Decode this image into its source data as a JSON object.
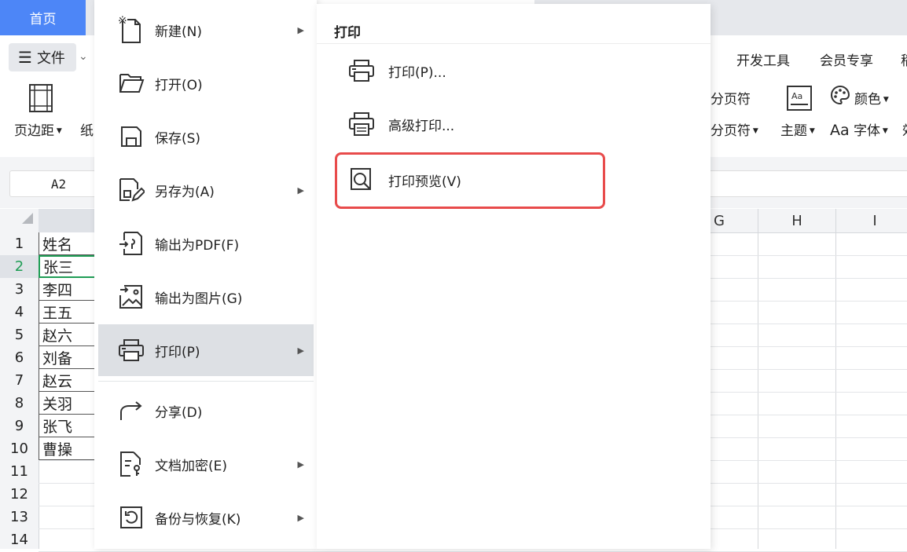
{
  "tabs": {
    "home": "首页"
  },
  "ribbon": {
    "file_label": "文件",
    "page_margin": "页边距",
    "paper": "纸",
    "page_break_1": "分页符",
    "page_break_2": "分页符",
    "theme": "主题",
    "color": "颜色",
    "font": "字体",
    "font_prefix": "Aa",
    "dev_tools": "开发工具",
    "member": "会员专享",
    "cut_tab": "稻",
    "cut_item": "效"
  },
  "formula": {
    "name_box": "A2"
  },
  "columns": [
    "G",
    "H",
    "I"
  ],
  "rows": [
    "1",
    "2",
    "3",
    "4",
    "5",
    "6",
    "7",
    "8",
    "9",
    "10",
    "11",
    "12",
    "13",
    "14"
  ],
  "cells": [
    "姓名",
    "张三",
    "李四",
    "王五",
    "赵六",
    "刘备",
    "赵云",
    "关羽",
    "张飞",
    "曹操"
  ],
  "file_menu": {
    "items": [
      {
        "label": "新建(N)",
        "icon": "new-file-icon",
        "submenu": true
      },
      {
        "label": "打开(O)",
        "icon": "folder-open-icon",
        "submenu": false
      },
      {
        "label": "保存(S)",
        "icon": "save-icon",
        "submenu": false
      },
      {
        "label": "另存为(A)",
        "icon": "save-as-icon",
        "submenu": true
      },
      {
        "label": "输出为PDF(F)",
        "icon": "export-pdf-icon",
        "submenu": false
      },
      {
        "label": "输出为图片(G)",
        "icon": "export-image-icon",
        "submenu": false
      },
      {
        "label": "打印(P)",
        "icon": "printer-icon",
        "submenu": true
      },
      {
        "label": "分享(D)",
        "icon": "share-icon",
        "submenu": false
      },
      {
        "label": "文档加密(E)",
        "icon": "encrypt-icon",
        "submenu": true
      },
      {
        "label": "备份与恢复(K)",
        "icon": "backup-icon",
        "submenu": true
      }
    ],
    "active_index": 6
  },
  "print_submenu": {
    "title": "打印",
    "items": [
      {
        "label": "打印(P)...",
        "icon": "printer-icon"
      },
      {
        "label": "高级打印...",
        "icon": "advanced-print-icon"
      },
      {
        "label": "打印预览(V)",
        "icon": "print-preview-icon"
      }
    ]
  },
  "colors": {
    "accent": "#4d86f7",
    "highlight": "#e84b4b",
    "active_row": "#dde0e4"
  }
}
